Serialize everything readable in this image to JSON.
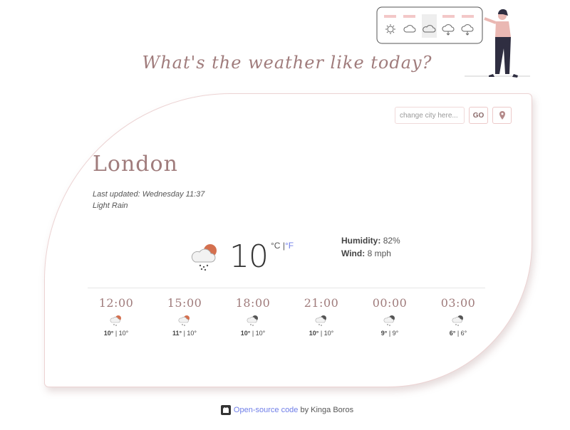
{
  "heading": "What's the weather like today?",
  "search": {
    "placeholder": "change city here...",
    "go_label": "GO"
  },
  "city": "London",
  "last_updated": "Last updated: Wednesday 11:37",
  "description": "Light Rain",
  "current": {
    "temp": "10",
    "unit_c": "°C",
    "unit_f": "°F"
  },
  "details": {
    "humidity_label": "Humidity:",
    "humidity_value": "82%",
    "wind_label": "Wind:",
    "wind_value": "8 mph"
  },
  "forecast": [
    {
      "time": "12:00",
      "max": "10°",
      "min": "10°",
      "icon": "sun-cloud-rain-icon"
    },
    {
      "time": "15:00",
      "max": "11°",
      "min": "10°",
      "icon": "sun-cloud-rain-icon"
    },
    {
      "time": "18:00",
      "max": "10°",
      "min": "10°",
      "icon": "moon-cloud-rain-icon"
    },
    {
      "time": "21:00",
      "max": "10°",
      "min": "10°",
      "icon": "moon-cloud-rain-icon"
    },
    {
      "time": "00:00",
      "max": "9°",
      "min": "9°",
      "icon": "moon-cloud-rain-icon"
    },
    {
      "time": "03:00",
      "max": "6°",
      "min": "6°",
      "icon": "moon-cloud-rain-icon"
    }
  ],
  "footer": {
    "link_text": "Open-source code",
    "by_text": " by Kinga Boros"
  },
  "colors": {
    "accent": "#a07c7c",
    "link": "#6f7ee8",
    "sun": "#d4704f",
    "border": "#ecd3d3"
  }
}
